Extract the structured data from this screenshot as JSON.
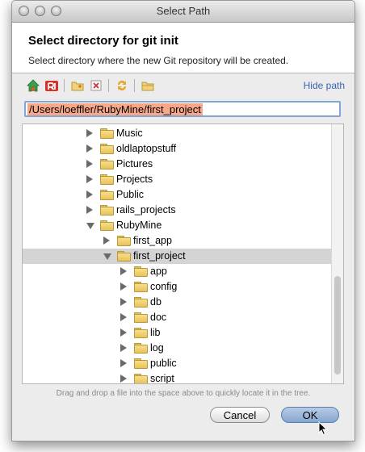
{
  "window": {
    "title": "Select Path"
  },
  "header": {
    "title": "Select directory for git init",
    "description": "Select directory where the new Git repository will be created."
  },
  "toolbar": {
    "buttons": [
      "home-icon",
      "project-icon",
      "new-folder-icon",
      "delete-icon",
      "refresh-icon",
      "show-hidden-icon"
    ],
    "hide_path_label": "Hide path"
  },
  "path": {
    "value": "/Users/loeffler/RubyMine/first_project"
  },
  "tree": {
    "items": [
      {
        "label": "Music",
        "expanded": false,
        "selected": false
      },
      {
        "label": "oldlaptopstuff",
        "expanded": false,
        "selected": false
      },
      {
        "label": "Pictures",
        "expanded": false,
        "selected": false
      },
      {
        "label": "Projects",
        "expanded": false,
        "selected": false
      },
      {
        "label": "Public",
        "expanded": false,
        "selected": false
      },
      {
        "label": "rails_projects",
        "expanded": false,
        "selected": false
      },
      {
        "label": "RubyMine",
        "expanded": true,
        "selected": false
      },
      {
        "label": "first_app",
        "expanded": false,
        "selected": false
      },
      {
        "label": "first_project",
        "expanded": true,
        "selected": true
      },
      {
        "label": "app",
        "expanded": false,
        "selected": false
      },
      {
        "label": "config",
        "expanded": false,
        "selected": false
      },
      {
        "label": "db",
        "expanded": false,
        "selected": false
      },
      {
        "label": "doc",
        "expanded": false,
        "selected": false
      },
      {
        "label": "lib",
        "expanded": false,
        "selected": false
      },
      {
        "label": "log",
        "expanded": false,
        "selected": false
      },
      {
        "label": "public",
        "expanded": false,
        "selected": false
      },
      {
        "label": "script",
        "expanded": false,
        "selected": false
      }
    ]
  },
  "hint": "Drag and drop a file into the space above to quickly locate it in the tree.",
  "buttons": {
    "cancel": "Cancel",
    "ok": "OK"
  },
  "colors": {
    "selection": "#d4d4d4",
    "path_highlight": "#f6a888",
    "link": "#3a62b8"
  }
}
